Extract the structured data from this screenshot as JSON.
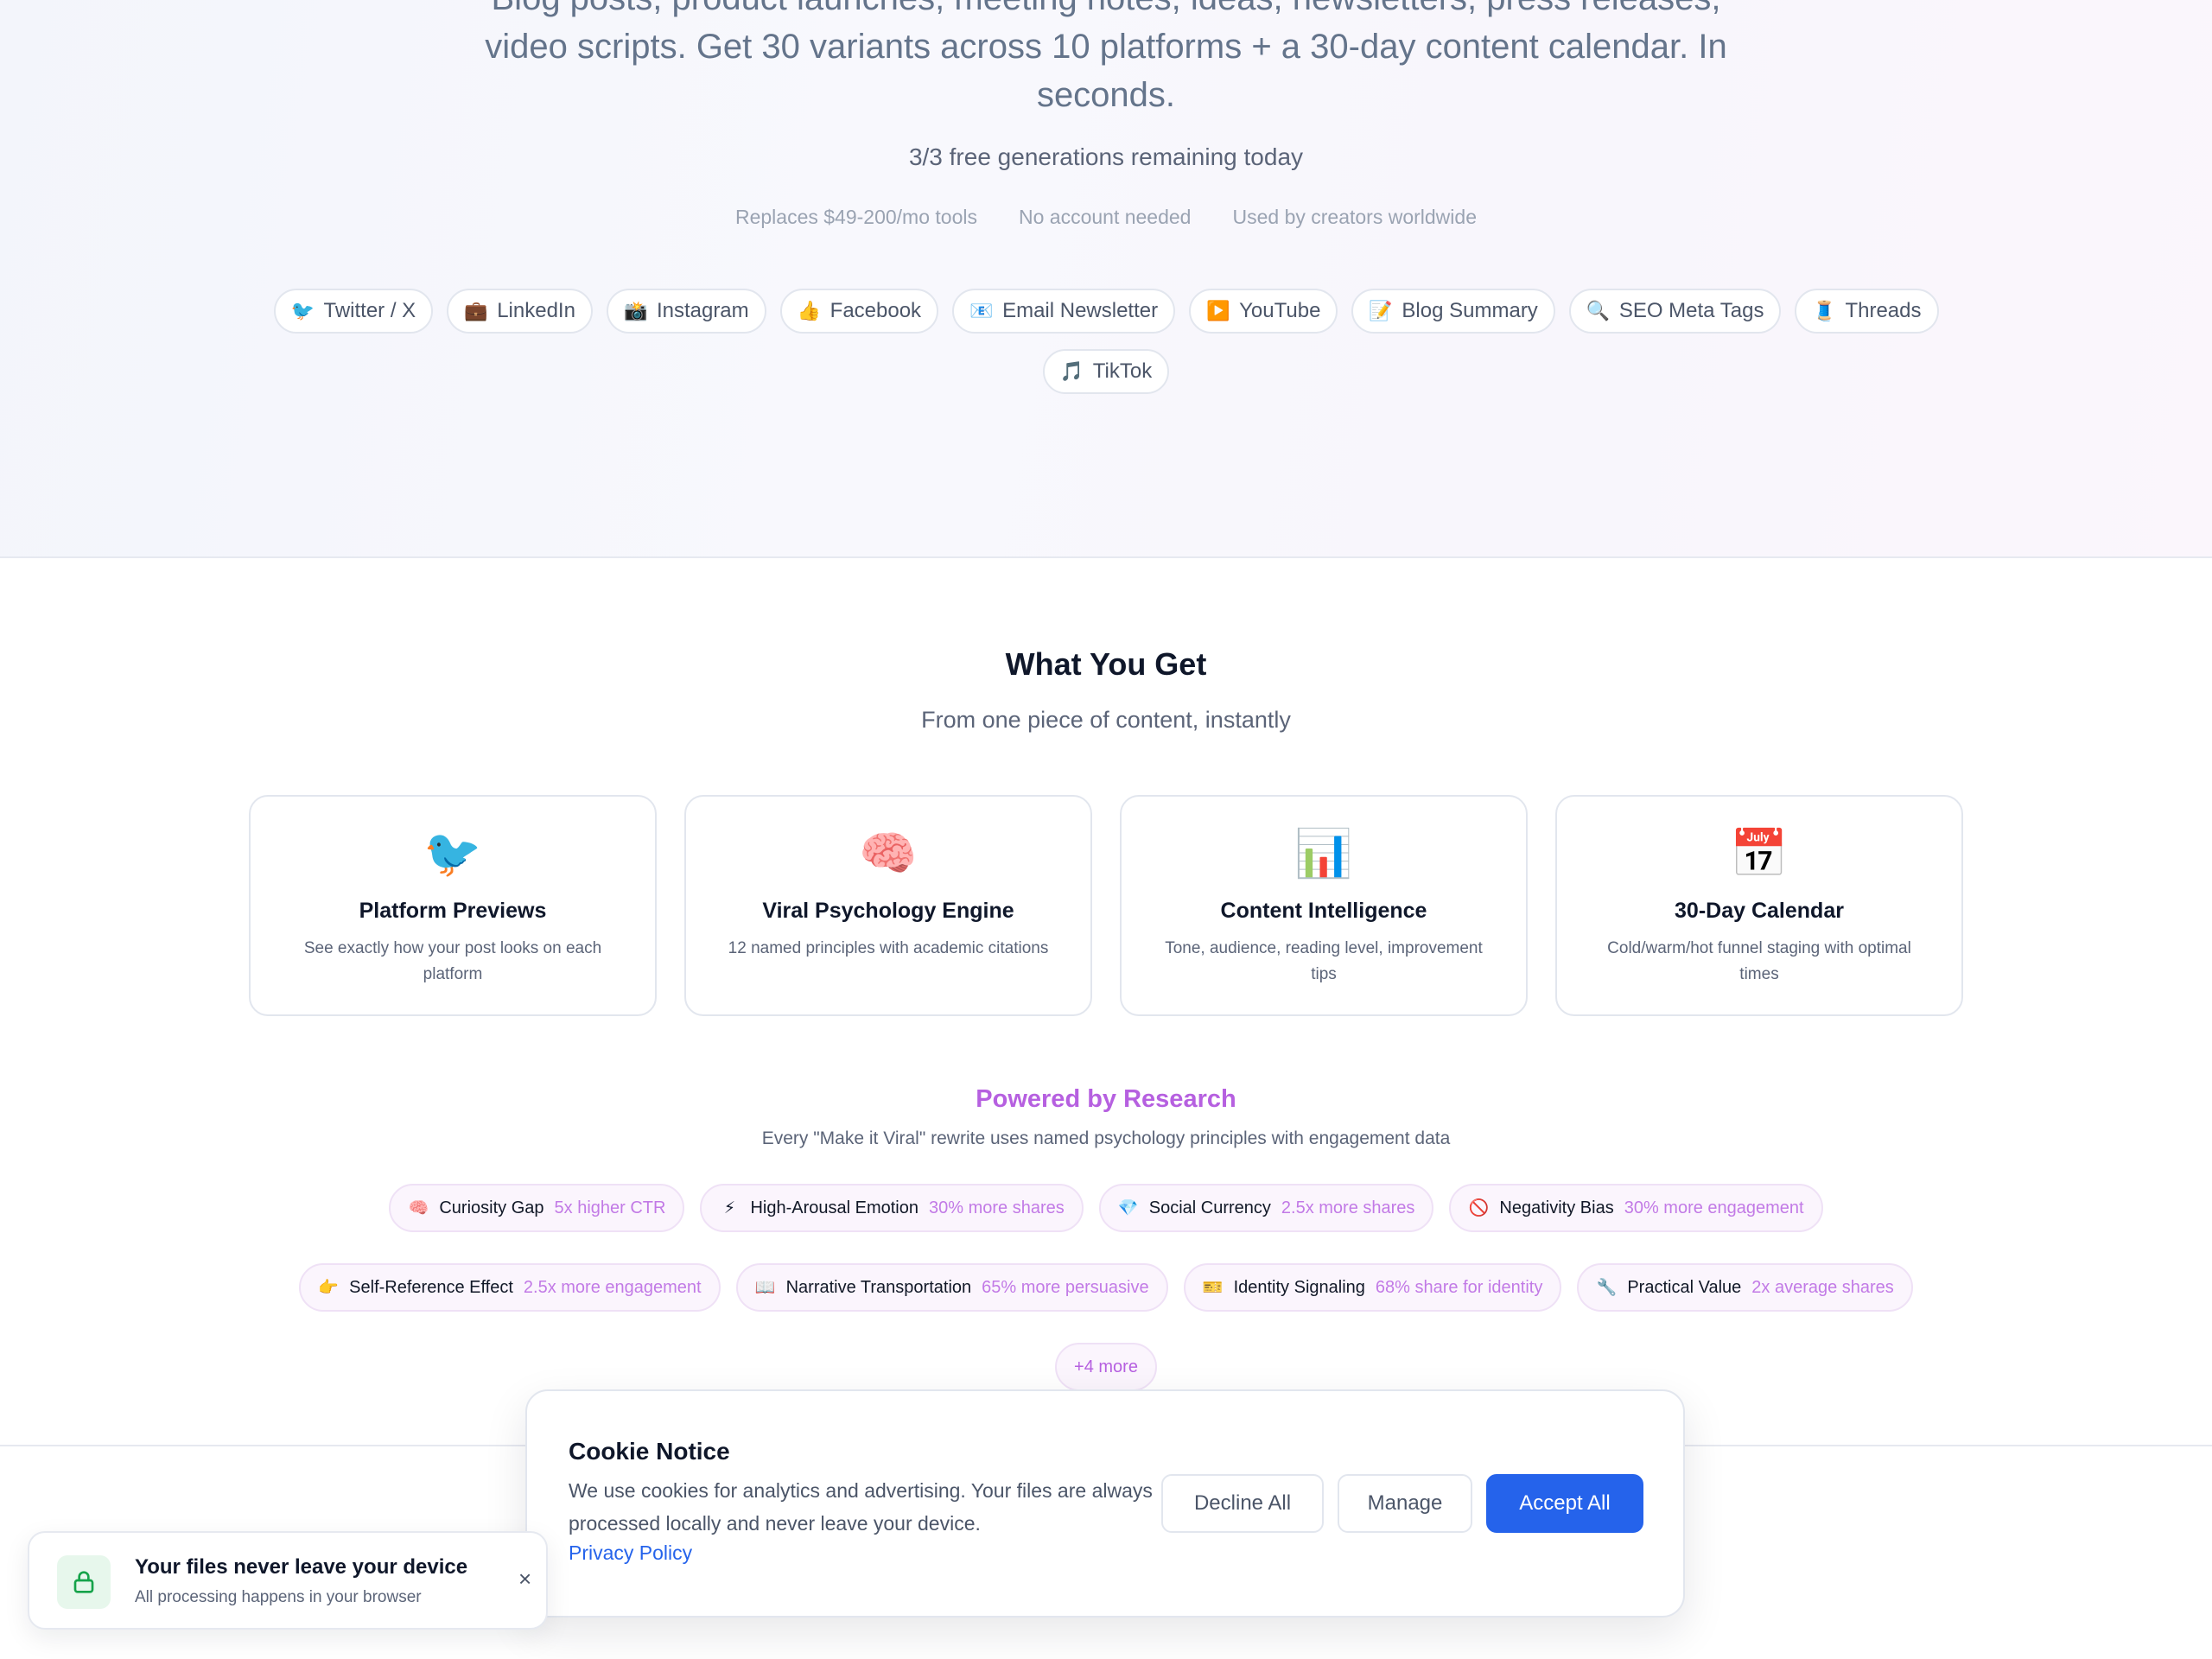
{
  "hero": {
    "description": "Blog posts, product launches, meeting notes, ideas, newsletters, press releases, video scripts. Get 30 variants across 10 platforms + a 30-day content calendar. In seconds.",
    "remaining": "3/3 free generations remaining today",
    "trust": [
      "Replaces $49-200/mo tools",
      "No account needed",
      "Used by creators worldwide"
    ],
    "platforms": [
      {
        "icon": "🐦",
        "label": "Twitter / X"
      },
      {
        "icon": "💼",
        "label": "LinkedIn"
      },
      {
        "icon": "📸",
        "label": "Instagram"
      },
      {
        "icon": "👍",
        "label": "Facebook"
      },
      {
        "icon": "📧",
        "label": "Email Newsletter"
      },
      {
        "icon": "▶️",
        "label": "YouTube"
      },
      {
        "icon": "📝",
        "label": "Blog Summary"
      },
      {
        "icon": "🔍",
        "label": "SEO Meta Tags"
      },
      {
        "icon": "🧵",
        "label": "Threads"
      },
      {
        "icon": "🎵",
        "label": "TikTok"
      }
    ]
  },
  "features": {
    "title": "What You Get",
    "subtitle": "From one piece of content, instantly",
    "cards": [
      {
        "icon": "🐦",
        "title": "Platform Previews",
        "desc": "See exactly how your post looks on each platform"
      },
      {
        "icon": "🧠",
        "title": "Viral Psychology Engine",
        "desc": "12 named principles with academic citations"
      },
      {
        "icon": "📊",
        "title": "Content Intelligence",
        "desc": "Tone, audience, reading level, improvement tips"
      },
      {
        "icon": "📅",
        "title": "30-Day Calendar",
        "desc": "Cold/warm/hot funnel staging with optimal times"
      }
    ]
  },
  "research": {
    "title": "Powered by Research",
    "subtitle": "Every \"Make it Viral\" rewrite uses named psychology principles with engagement data",
    "principles": [
      {
        "icon": "🧠",
        "name": "Curiosity Gap",
        "stat": "5x higher CTR"
      },
      {
        "icon": "⚡",
        "name": "High-Arousal Emotion",
        "stat": "30% more shares"
      },
      {
        "icon": "💎",
        "name": "Social Currency",
        "stat": "2.5x more shares"
      },
      {
        "icon": "🚫",
        "name": "Negativity Bias",
        "stat": "30% more engagement"
      },
      {
        "icon": "👉",
        "name": "Self-Reference Effect",
        "stat": "2.5x more engagement"
      },
      {
        "icon": "📖",
        "name": "Narrative Transportation",
        "stat": "65% more persuasive"
      },
      {
        "icon": "🎫",
        "name": "Identity Signaling",
        "stat": "68% share for identity"
      },
      {
        "icon": "🔧",
        "name": "Practical Value",
        "stat": "2x average shares"
      }
    ],
    "more_label": "+4 more"
  },
  "cookie": {
    "title": "Cookie Notice",
    "text": "We use cookies for analytics and advertising. Your files are always processed locally and never leave your device.",
    "link": "Privacy Policy",
    "decline": "Decline All",
    "manage": "Manage",
    "accept": "Accept All"
  },
  "toast": {
    "title": "Your files never leave your device",
    "subtitle": "All processing happens in your browser",
    "close": "×"
  },
  "colors": {
    "accent": "#2563eb",
    "research": "#b660e0",
    "lock": "#16a34a"
  }
}
